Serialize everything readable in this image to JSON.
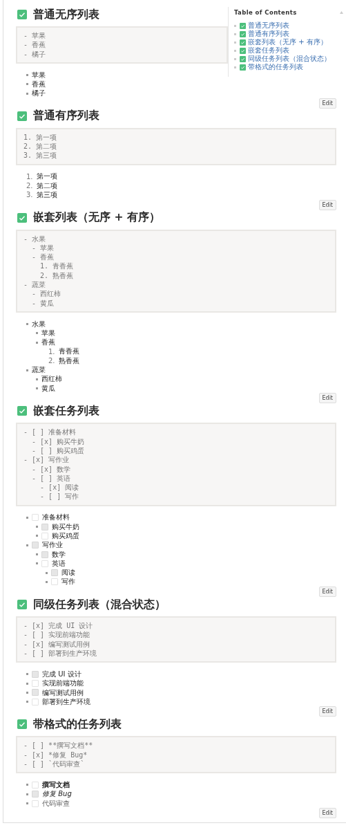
{
  "toc": {
    "title": "Table of Contents",
    "items": [
      {
        "text": "普通无序列表"
      },
      {
        "text": "普通有序列表"
      },
      {
        "text": "嵌套列表（无序 + 有序）"
      },
      {
        "text": "嵌套任务列表"
      },
      {
        "text": "同级任务列表（混合状态）"
      },
      {
        "text": "带格式的任务列表"
      }
    ]
  },
  "sections": [
    {
      "title": "普通无序列表",
      "source": [
        "- 苹果",
        "- 香蕉",
        "- 橘子"
      ],
      "list": {
        "kind": "unordered",
        "items": [
          {
            "text": "苹果"
          },
          {
            "text": "香蕉"
          },
          {
            "text": "橘子"
          }
        ]
      },
      "edit": "Edit"
    },
    {
      "title": "普通有序列表",
      "source": [
        "1. 第一项",
        "2. 第二项",
        "3. 第三项"
      ],
      "list": {
        "kind": "ordered",
        "items": [
          {
            "number": "1.",
            "text": "第一项"
          },
          {
            "number": "2.",
            "text": "第二项"
          },
          {
            "number": "3.",
            "text": "第三项"
          }
        ]
      },
      "edit": "Edit"
    },
    {
      "title": "嵌套列表（无序 + 有序）",
      "source": [
        "- 水果",
        "  - 苹果",
        "  - 香蕉",
        "    1. 青香蕉",
        "    2. 熟香蕉",
        "- 蔬菜",
        "  - 西红柿",
        "  - 黄瓜"
      ],
      "list": {
        "kind": "unordered",
        "items": [
          {
            "text": "水果",
            "children": {
              "kind": "unordered",
              "items": [
                {
                  "text": "苹果"
                },
                {
                  "text": "香蕉",
                  "children": {
                    "kind": "ordered",
                    "items": [
                      {
                        "number": "1.",
                        "text": "青香蕉"
                      },
                      {
                        "number": "2.",
                        "text": "熟香蕉"
                      }
                    ]
                  }
                }
              ]
            }
          },
          {
            "text": "蔬菜",
            "children": {
              "kind": "unordered",
              "items": [
                {
                  "text": "西红柿"
                },
                {
                  "text": "黄瓜"
                }
              ]
            }
          }
        ]
      },
      "edit": "Edit"
    },
    {
      "title": "嵌套任务列表",
      "source": [
        "- [ ] 准备材料",
        "  - [x] 购买牛奶",
        "  - [ ] 购买鸡蛋",
        "- [x] 写作业",
        "  - [x] 数学",
        "  - [ ] 英语",
        "    - [x] 阅读",
        "    - [ ] 写作"
      ],
      "list": {
        "kind": "unordered",
        "items": [
          {
            "text": "准备材料",
            "checked": false,
            "children": {
              "kind": "unordered",
              "items": [
                {
                  "text": "购买牛奶",
                  "checked": true
                },
                {
                  "text": "购买鸡蛋",
                  "checked": false
                }
              ]
            }
          },
          {
            "text": "写作业",
            "checked": true,
            "children": {
              "kind": "unordered",
              "items": [
                {
                  "text": "数学",
                  "checked": true
                },
                {
                  "text": "英语",
                  "checked": false,
                  "children": {
                    "kind": "unordered",
                    "items": [
                      {
                        "text": "阅读",
                        "checked": true
                      },
                      {
                        "text": "写作",
                        "checked": false
                      }
                    ]
                  }
                }
              ]
            }
          }
        ]
      },
      "edit": "Edit"
    },
    {
      "title": "同级任务列表（混合状态）",
      "source": [
        "- [x] 完成 UI 设计",
        "- [ ] 实现前端功能",
        "- [x] 编写测试用例",
        "- [ ] 部署到生产环境"
      ],
      "list": {
        "kind": "unordered",
        "items": [
          {
            "text": "完成 UI 设计",
            "checked": true
          },
          {
            "text": "实现前端功能",
            "checked": false
          },
          {
            "text": "编写测试用例",
            "checked": true
          },
          {
            "text": "部署到生产环境",
            "checked": false
          }
        ]
      },
      "edit": "Edit"
    },
    {
      "title": "带格式的任务列表",
      "source": [
        "- [ ] **撰写文档**",
        "- [x] *修复 Bug*",
        "- [ ] `代码审查`"
      ],
      "list": {
        "kind": "unordered",
        "items": [
          {
            "text": "撰写文档",
            "checked": false,
            "kind": "bold"
          },
          {
            "text": "修复 Bug",
            "checked": true,
            "kind": "italic"
          },
          {
            "text": "代码审查",
            "checked": false,
            "kind": "code"
          }
        ]
      },
      "edit": "Edit"
    }
  ]
}
